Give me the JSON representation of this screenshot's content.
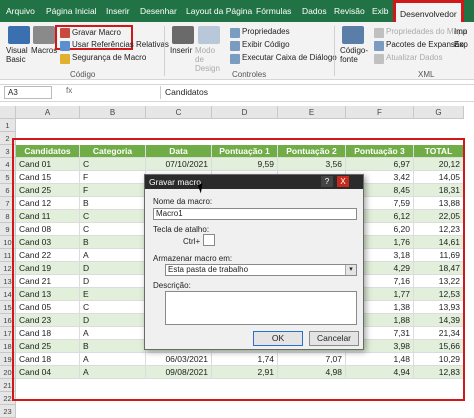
{
  "menu": {
    "tabs": [
      "Arquivo",
      "Página Inicial",
      "Inserir",
      "Desenhar",
      "Layout da Página",
      "Fórmulas",
      "Dados",
      "Revisão",
      "Exib",
      "Desenvolvedor"
    ]
  },
  "ribbon": {
    "visual_basic": "Visual Basic",
    "macros": "Macros",
    "gravar_macro": "Gravar Macro",
    "usar_ref": "Usar Referências Relativas",
    "seguranca": "Segurança de Macro",
    "group_codigo": "Código",
    "inserir": "Inserir",
    "modo_design": "Modo de Design",
    "propriedades": "Propriedades",
    "exibir_codigo": "Exibir Código",
    "executar_caixa": "Executar Caixa de Diálogo",
    "group_controles": "Controles",
    "codigo_fonte": "Código-fonte",
    "propriedades_mapa": "Propriedades do Mapa",
    "pacotes_expansao": "Pacotes de Expansão",
    "atualizar_dados": "Atualizar Dados",
    "group_xml": "XML",
    "imp": "Imp",
    "exp": "Exp"
  },
  "formula_bar": {
    "name_box": "A3",
    "fx": "fx",
    "value": "Candidatos"
  },
  "columns": [
    "A",
    "B",
    "C",
    "D",
    "E",
    "F",
    "G"
  ],
  "row_numbers": [
    "1",
    "2",
    "3",
    "4",
    "5",
    "6",
    "7",
    "8",
    "9",
    "10",
    "11",
    "12",
    "13",
    "14",
    "15",
    "16",
    "17",
    "18",
    "19",
    "20",
    "21",
    "22",
    "23"
  ],
  "table": {
    "headers": [
      "Candidatos",
      "Categoria",
      "Data",
      "Pontuação 1",
      "Pontuação 2",
      "Pontuação 3",
      "TOTAL"
    ],
    "rows": [
      [
        "Cand 01",
        "C",
        "07/10/2021",
        "9,59",
        "3,56",
        "6,97",
        "20,12"
      ],
      [
        "Cand 15",
        "F",
        "",
        "",
        "",
        "3,42",
        "14,05"
      ],
      [
        "Cand 25",
        "F",
        "",
        "",
        "",
        "8,45",
        "18,31"
      ],
      [
        "Cand 12",
        "B",
        "",
        "",
        "",
        "7,59",
        "13,88"
      ],
      [
        "Cand 11",
        "C",
        "",
        "",
        "",
        "6,12",
        "22,05"
      ],
      [
        "Cand 08",
        "C",
        "",
        "",
        "",
        "6,20",
        "12,23"
      ],
      [
        "Cand 03",
        "B",
        "",
        "",
        "",
        "1,76",
        "14,61"
      ],
      [
        "Cand 22",
        "A",
        "",
        "",
        "",
        "3,18",
        "11,69"
      ],
      [
        "Cand 19",
        "D",
        "",
        "",
        "",
        "4,29",
        "18,47"
      ],
      [
        "Cand 21",
        "D",
        "",
        "",
        "",
        "7,16",
        "13,22"
      ],
      [
        "Cand 13",
        "E",
        "",
        "",
        "",
        "1,77",
        "12,53"
      ],
      [
        "Cand 05",
        "C",
        "",
        "",
        "",
        "1,38",
        "13,93"
      ],
      [
        "Cand 23",
        "D",
        "",
        "",
        "",
        "1,88",
        "14,39"
      ],
      [
        "Cand 18",
        "A",
        "",
        "",
        "",
        "7,31",
        "21,34"
      ],
      [
        "Cand 25",
        "B",
        "23/12/2021",
        "3,04",
        "8,64",
        "3,98",
        "15,66"
      ],
      [
        "Cand 18",
        "A",
        "06/03/2021",
        "1,74",
        "7,07",
        "1,48",
        "10,29"
      ],
      [
        "Cand 04",
        "A",
        "09/08/2021",
        "2,91",
        "4,98",
        "4,94",
        "12,83"
      ]
    ]
  },
  "dialog": {
    "title": "Gravar macro",
    "help": "?",
    "close": "X",
    "nome_label": "Nome da macro:",
    "nome_value": "Macro1",
    "tecla_label": "Tecla de atalho:",
    "ctrl_label": "Ctrl+",
    "armazenar_label": "Armazenar macro em:",
    "armazenar_value": "Esta pasta de trabalho",
    "descricao_label": "Descrição:",
    "ok": "OK",
    "cancelar": "Cancelar"
  },
  "colors": {
    "header_green": "#70ad47",
    "band": "#e2efda",
    "excel_green": "#217346",
    "highlight_red": "#d01818"
  }
}
